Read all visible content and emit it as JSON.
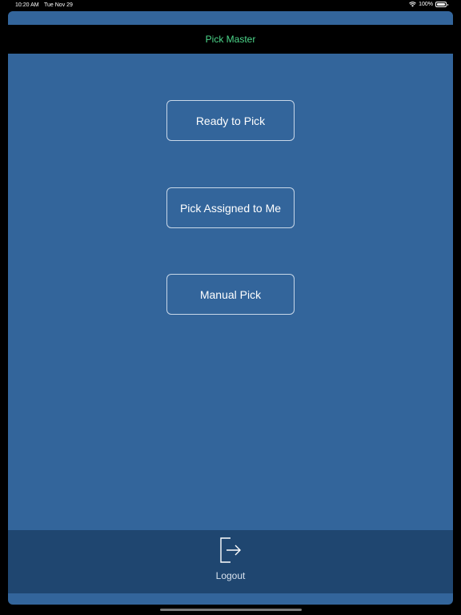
{
  "status_bar": {
    "time": "10:20 AM",
    "date": "Tue Nov 29",
    "battery": "100%"
  },
  "nav": {
    "title": "Pick Master"
  },
  "menu": {
    "ready_to_pick": "Ready to Pick",
    "pick_assigned": "Pick Assigned to Me",
    "manual_pick": "Manual Pick"
  },
  "tab_bar": {
    "logout_label": "Logout"
  },
  "colors": {
    "background": "#33659b",
    "nav_background": "#000000",
    "nav_title": "#4cd68a",
    "tab_bar": "#1f4670"
  },
  "icons": {
    "logout": "logout-icon",
    "wifi": "wifi-icon",
    "battery": "battery-icon"
  }
}
